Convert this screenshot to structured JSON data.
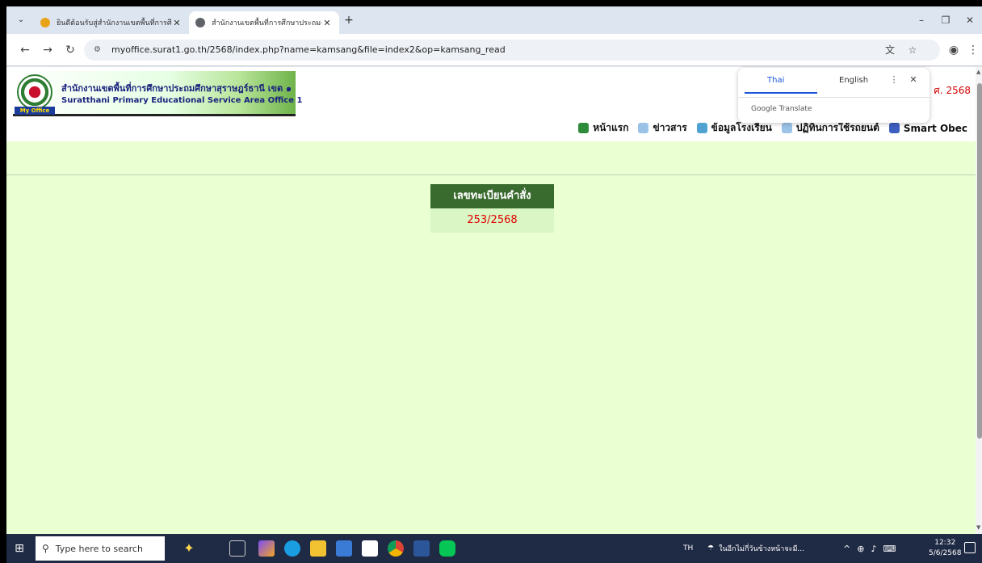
{
  "browser": {
    "tabs": [
      {
        "title": "ยินดีต้อนรับสู่สำนักงานเขตพื้นที่การศึ",
        "favicon_color": "#e8a317",
        "active": false
      },
      {
        "title": "สำนักงานเขตพื้นที่การศึกษาประถมศึ",
        "favicon_color": "#5f6368",
        "active": true
      }
    ],
    "new_tab": "+",
    "url": "myoffice.surat1.go.th/2568/index.php?name=kamsang&file=index2&op=kamsang_read",
    "window_controls": {
      "minimize": "–",
      "restore": "❐",
      "close": "✕"
    }
  },
  "site": {
    "logo_tag": "My Office",
    "org_name_th": "สำนักงานเขตพื้นที่การศึกษาประถมศึกษาสุราษฎร์ธานี เขต ๑",
    "org_name_en": "Suratthani Primary Educational Service Area Office 1",
    "year_text": "ศ. 2568",
    "menu": [
      {
        "label": "หน้าแรก",
        "icon": "home-icon",
        "color": "#2e8b3a"
      },
      {
        "label": "ข่าวสาร",
        "icon": "news-icon",
        "color": "#9bc3e8"
      },
      {
        "label": "ข้อมูลโรงเรียน",
        "icon": "school-icon",
        "color": "#4fa3d1"
      },
      {
        "label": "ปฏิทินการใช้รถยนต์",
        "icon": "calendar-icon",
        "color": "#9bc3e8"
      },
      {
        "label": "Smart Obec",
        "icon": "book-icon",
        "color": "#3d5fbf"
      }
    ]
  },
  "register": {
    "header": "เลขทะเบียนคำสั่ง",
    "value": "253/2568"
  },
  "translate_popup": {
    "source_lang": "Thai",
    "target_lang": "English",
    "brand": "Google Translate"
  },
  "taskbar": {
    "search_placeholder": "Type here to search",
    "ime": "TH",
    "weather": "ในอีกไม่กี่วันข้างหน้าจะมี...",
    "time": "12:32",
    "date": "5/6/2568"
  },
  "colors": {
    "page_bg": "#eaffd2",
    "register_header_bg": "#3a6b2e",
    "register_value": "#e00000"
  }
}
